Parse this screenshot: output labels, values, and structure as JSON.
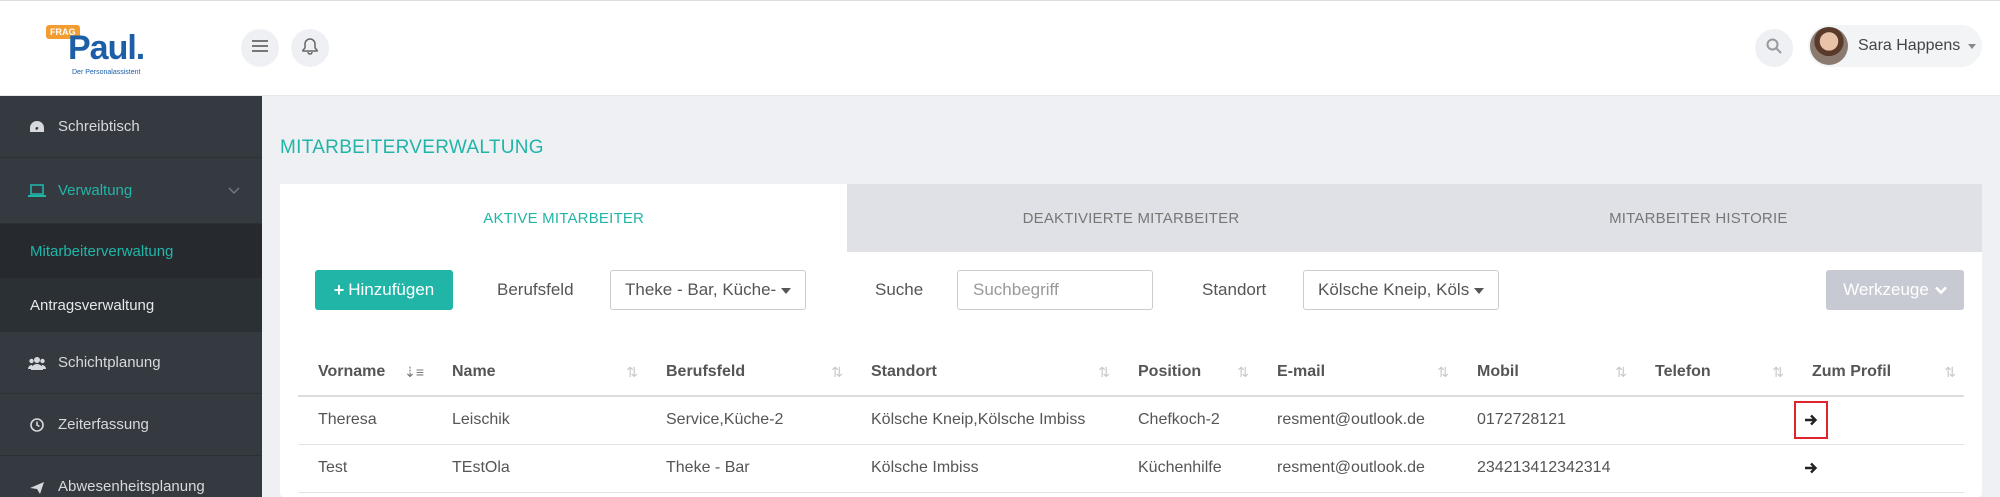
{
  "header": {
    "logo_badge": "FRAG",
    "logo_name": "Paul.",
    "logo_tagline": "Der Personalassistent",
    "user_name": "Sara Happens"
  },
  "sidebar": {
    "items": [
      {
        "label": "Schreibtisch",
        "icon": "dashboard-icon"
      },
      {
        "label": "Verwaltung",
        "icon": "laptop-icon"
      },
      {
        "label": "Mitarbeiterverwaltung"
      },
      {
        "label": "Antragsverwaltung"
      },
      {
        "label": "Schichtplanung",
        "icon": "users-icon"
      },
      {
        "label": "Zeiterfassung",
        "icon": "clock-icon"
      },
      {
        "label": "Abwesenheitsplanung",
        "icon": "plane-icon"
      }
    ]
  },
  "main": {
    "title": "MITARBEITERVERWALTUNG",
    "tabs": [
      {
        "label": "AKTIVE MITARBEITER"
      },
      {
        "label": "DEAKTIVIERTE MITARBEITER"
      },
      {
        "label": "MITARBEITER HISTORIE"
      }
    ],
    "toolbar": {
      "add_label": "Hinzufügen",
      "berufsfeld_label": "Berufsfeld",
      "berufsfeld_value": "Theke - Bar, Küche-",
      "suche_label": "Suche",
      "suche_placeholder": "Suchbegriff",
      "standort_label": "Standort",
      "standort_value": "Kölsche Kneip, Köls",
      "tools_label": "Werkzeuge"
    },
    "table": {
      "columns": [
        "Vorname",
        "Name",
        "Berufsfeld",
        "Standort",
        "Position",
        "E-mail",
        "Mobil",
        "Telefon",
        "Zum Profil"
      ],
      "rows": [
        [
          "Theresa",
          "Leischik",
          "Service,Küche-2",
          "Kölsche Kneip,Kölsche Imbiss",
          "Chefkoch-2",
          "resment@outlook.de",
          "0172728121",
          ""
        ],
        [
          "Test",
          "TEstOla",
          "Theke - Bar",
          "Kölsche Imbiss",
          "Küchenhilfe",
          "resment@outlook.de",
          "234213412342314",
          ""
        ]
      ]
    }
  },
  "colors": {
    "accent": "#21b5a8",
    "sidebar": "#343a40",
    "highlight": "#e0242b"
  }
}
